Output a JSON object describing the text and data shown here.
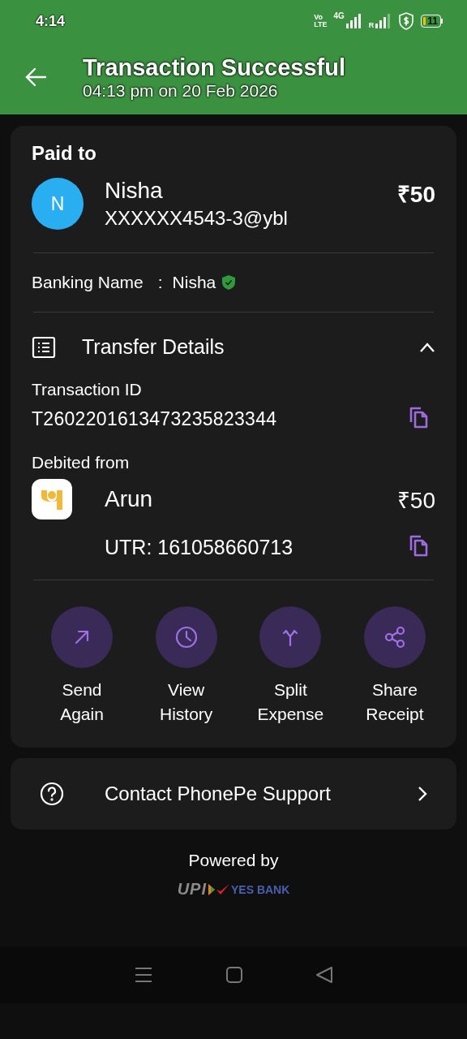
{
  "status_bar": {
    "time": "4:14",
    "volte_top": "Vo",
    "volte_bottom": "LTE",
    "network": "4G",
    "roaming": "R",
    "battery": "11"
  },
  "header": {
    "title": "Transaction Successful",
    "subtitle": "04:13 pm on 20 Feb 2026"
  },
  "paid_to": {
    "heading": "Paid to",
    "avatar": "N",
    "name": "Nisha",
    "upi_id": "XXXXXX4543-3@ybl",
    "amount": "₹50",
    "banking_label": "Banking Name",
    "separator": ":",
    "banking_name": "Nisha",
    "verified": true
  },
  "transfer_details": {
    "title": "Transfer Details",
    "expanded": true,
    "transaction_id_label": "Transaction ID",
    "transaction_id": "T2602201613473235823344",
    "debited_label": "Debited from",
    "account_name": "Arun",
    "amount": "₹50",
    "utr": "UTR: 161058660713"
  },
  "actions": [
    {
      "kind": "send",
      "label": "Send Again"
    },
    {
      "kind": "history",
      "label": "View History"
    },
    {
      "kind": "split",
      "label": "Split Expense"
    },
    {
      "kind": "share",
      "label": "Share Receipt"
    }
  ],
  "support": {
    "label": "Contact PhonePe Support"
  },
  "footer": {
    "powered_by": "Powered by",
    "upi": "UPI",
    "bank": "YES BANK"
  }
}
